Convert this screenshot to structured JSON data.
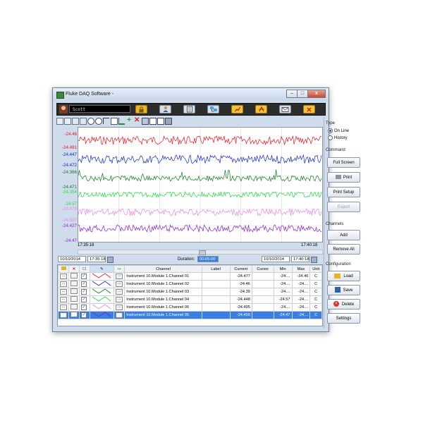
{
  "window": {
    "title": "Fluke DAQ Software -"
  },
  "user": {
    "name": "Scott"
  },
  "toolbar_icons": [
    "lock-icon",
    "user-settings-icon",
    "list-icon",
    "instruments-icon",
    "chart-report-icon",
    "scan-icon",
    "email-icon",
    "close-icon"
  ],
  "chart_data": {
    "type": "line",
    "x_start": "17:35:18",
    "x_end": "17:40:18",
    "series": [
      {
        "color": "#e8141e",
        "top": "-24.46",
        "bottom": "-24.491"
      },
      {
        "color": "#1428d2",
        "top": "-24.447",
        "bottom": "-24.472"
      },
      {
        "color": "#0e7a1c",
        "top": "-24.366",
        "bottom": "-24.471"
      },
      {
        "color": "#1fdc3c",
        "top": "-24.354",
        "bottom": "-24.57"
      },
      {
        "color": "#ee82ee",
        "top": "-24.478",
        "bottom": "-24.507"
      },
      {
        "color": "#8a1ec8",
        "top": "-24.427",
        "bottom": "-24.47"
      }
    ]
  },
  "range": {
    "start_date": "10/10/2014",
    "start_time": "17:35:18",
    "duration_label": "Duration:",
    "duration": "00:05:00",
    "end_date": "10/10/2014",
    "end_time": "17:40:18"
  },
  "table": {
    "headers": [
      "Channel",
      "Label",
      "Current",
      "Cursor",
      "Min",
      "Max",
      "Unit"
    ],
    "rows": [
      {
        "channel": "Instrument 10.Module 1.Channel 01",
        "label": "",
        "current": "-24.477",
        "cursor": "",
        "min": "-24....",
        "max": "-24.46",
        "unit": "C",
        "color": "#e8141e"
      },
      {
        "channel": "Instrument 10.Module 1.Channel 02",
        "label": "",
        "current": "-24.46",
        "cursor": "",
        "min": "-24....",
        "max": "-24....",
        "unit": "C",
        "color": "#1428d2"
      },
      {
        "channel": "Instrument 10.Module 1.Channel 03",
        "label": "",
        "current": "-24.39",
        "cursor": "",
        "min": "-24....",
        "max": "-24....",
        "unit": "C",
        "color": "#0e7a1c"
      },
      {
        "channel": "Instrument 10.Module 1.Channel 04",
        "label": "",
        "current": "-24.448",
        "cursor": "",
        "min": "-24.57",
        "max": "-24....",
        "unit": "C",
        "color": "#1fdc3c"
      },
      {
        "channel": "Instrument 10.Module 1.Channel 06",
        "label": "",
        "current": "-24.495",
        "cursor": "",
        "min": "-24....",
        "max": "-24....",
        "unit": "C",
        "color": "#ee82ee"
      },
      {
        "channel": "Instrument 10.Module 1.Channel 05",
        "label": "",
        "current": "-24.459",
        "cursor": "",
        "min": "-24.47",
        "max": "-24....",
        "unit": "C",
        "color": "#8a1ec8",
        "selected": true
      }
    ]
  },
  "sidebar": {
    "type_label": "Type",
    "online": "On Line",
    "history": "History",
    "command_label": "Command",
    "full_screen": "Full Screen",
    "print": "Print",
    "print_setup": "Print Setup",
    "export": "Export",
    "channels_label": "Channels",
    "add": "Add",
    "remove_all": "Remove All",
    "configuration_label": "Configuration",
    "load": "Load",
    "save": "Save",
    "delete": "Delete",
    "settings": "Settings"
  }
}
